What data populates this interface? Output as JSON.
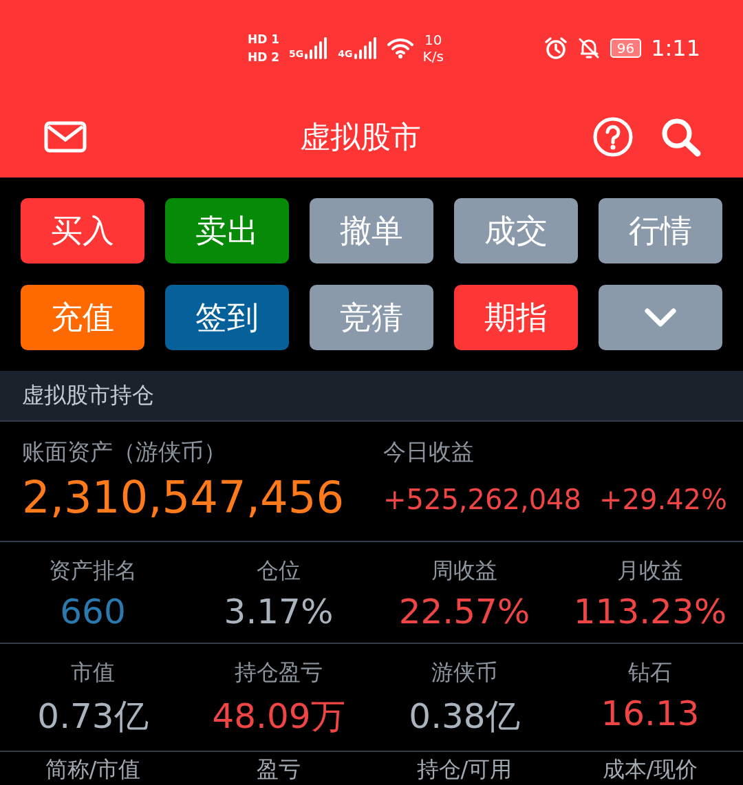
{
  "status_bar": {
    "sims": [
      {
        "badge": "HD",
        "slot": "1"
      },
      {
        "badge": "HD",
        "slot": "2"
      }
    ],
    "networks": [
      "5G",
      "4G"
    ],
    "speed": "10",
    "speed_unit": "K/s",
    "battery": "96",
    "time": "1:11"
  },
  "header": {
    "title": "虚拟股市"
  },
  "actions": [
    {
      "kind": "label",
      "label": "买入",
      "color": "#fe3636"
    },
    {
      "kind": "label",
      "label": "卖出",
      "color": "#078a07"
    },
    {
      "kind": "label",
      "label": "撤单",
      "color": "#8a9aab"
    },
    {
      "kind": "label",
      "label": "成交",
      "color": "#8a9aab"
    },
    {
      "kind": "label",
      "label": "行情",
      "color": "#8a9aab"
    },
    {
      "kind": "label",
      "label": "充值",
      "color": "#ff6a00"
    },
    {
      "kind": "label",
      "label": "签到",
      "color": "#06609a"
    },
    {
      "kind": "label",
      "label": "竞猜",
      "color": "#8a9aab"
    },
    {
      "kind": "label",
      "label": "期指",
      "color": "#fe3636"
    },
    {
      "kind": "more",
      "color": "#8a9aab"
    }
  ],
  "section_title": "虚拟股市持仓",
  "assets": {
    "label": "账面资产（游侠币）",
    "value": "2,310,547,456",
    "today_label": "今日收益",
    "today_value": "+525,262,048",
    "today_percent": "+29.42%"
  },
  "stat_rows": [
    [
      {
        "label": "资产排名",
        "value": "660",
        "color": "#2a7ab0"
      },
      {
        "label": "仓位",
        "value": "3.17%",
        "color": "#aab4bf"
      },
      {
        "label": "周收益",
        "value": "22.57%",
        "color": "#f04545"
      },
      {
        "label": "月收益",
        "value": "113.23%",
        "color": "#f04545"
      }
    ],
    [
      {
        "label": "市值",
        "value": "0.73亿",
        "color": "#aab4bf"
      },
      {
        "label": "持仓盈亏",
        "value": "48.09万",
        "color": "#f04545"
      },
      {
        "label": "游侠币",
        "value": "0.38亿",
        "color": "#aab4bf"
      },
      {
        "label": "钻石",
        "value": "16.13",
        "color": "#f04545"
      }
    ]
  ],
  "table": {
    "columns": [
      "简称/市值",
      "盈亏",
      "持仓/可用",
      "成本/现价"
    ]
  }
}
